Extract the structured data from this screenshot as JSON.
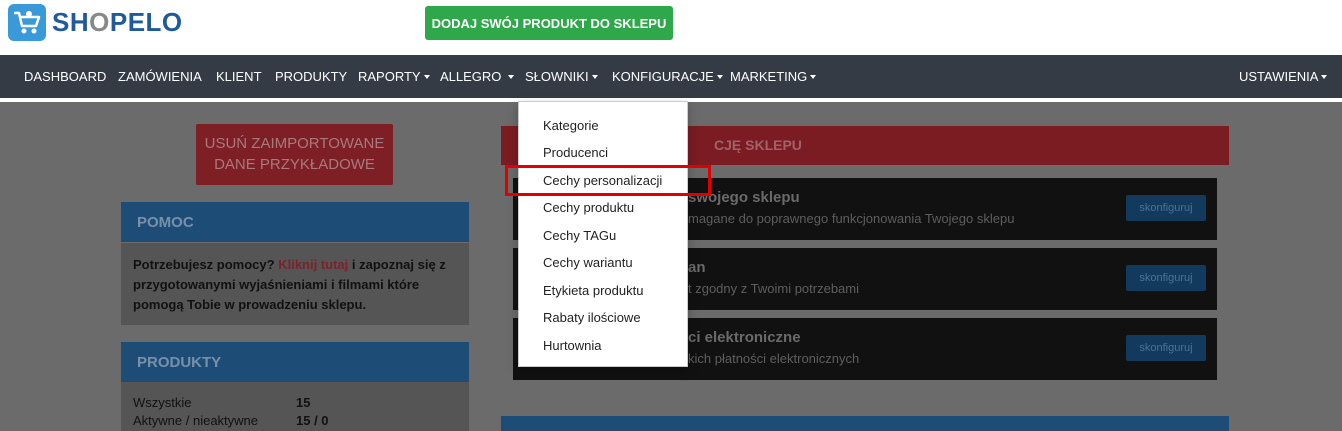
{
  "header": {
    "logo_text_sh": "SH",
    "logo_text_o": "O",
    "logo_text_pelo": "PELO",
    "add_product_label": "DODAJ SWÓJ PRODUKT DO SKLEPU"
  },
  "nav": {
    "items": [
      {
        "label": "DASHBOARD"
      },
      {
        "label": "ZAMÓWIENIA"
      },
      {
        "label": "KLIENT"
      },
      {
        "label": "PRODUKTY"
      },
      {
        "label": "RAPORTY"
      },
      {
        "label": "ALLEGRO"
      },
      {
        "label": "SŁOWNIKI"
      },
      {
        "label": "KONFIGURACJE"
      },
      {
        "label": "MARKETING"
      },
      {
        "label": "USTAWIENIA"
      }
    ]
  },
  "dropdown": {
    "items": [
      {
        "label": "Kategorie"
      },
      {
        "label": "Producenci"
      },
      {
        "label": "Cechy personalizacji"
      },
      {
        "label": "Cechy produktu"
      },
      {
        "label": "Cechy TAGu"
      },
      {
        "label": "Cechy wariantu"
      },
      {
        "label": "Etykieta produktu"
      },
      {
        "label": "Rabaty ilościowe"
      },
      {
        "label": "Hurtownia"
      }
    ]
  },
  "sidebar": {
    "remove_demo_label_1": "USUŃ ZAIMPORTOWANE",
    "remove_demo_label_2": "DANE PRZYKŁADOWE",
    "help_title": "POMOC",
    "help_text_1": "Potrzebujesz pomocy? ",
    "help_link": "Kliknij tutaj",
    "help_text_2": " i zapoznaj się z przygotowanymi wyjaśnieniami i filmami które pomogą Tobie w prowadzeniu sklepu.",
    "products_title": "PRODUKTY",
    "products_rows": [
      {
        "label": "Wszystkie",
        "value": "15"
      },
      {
        "label": "Aktywne / nieaktywne",
        "value": "15 / 0"
      }
    ]
  },
  "config": {
    "header_title": "CJĘ SKLEPU",
    "rows": [
      {
        "title": "swojego sklepu",
        "desc": "magane do poprawnego funkcjonowania Twojego sklepu",
        "button": "skonfiguruj"
      },
      {
        "title": "an",
        "desc": "t zgodny z Twoimi potrzebami",
        "button": "skonfiguruj"
      },
      {
        "title": "ci elektroniczne",
        "desc": "kich płatności elektronicznych",
        "button": "skonfiguruj"
      }
    ]
  },
  "colors": {
    "nav_bg": "#353b45",
    "green_button": "#2ea84a",
    "highlight": "#e00000"
  }
}
